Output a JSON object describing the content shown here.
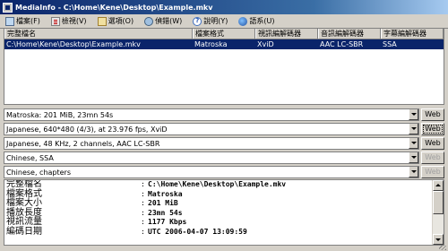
{
  "window": {
    "title": "MediaInfo - C:\\Home\\Kene\\Desktop\\Example.mkv"
  },
  "menu": [
    {
      "label": "檔案(F)",
      "icon": "file-icon"
    },
    {
      "label": "檢視(V)",
      "icon": "view-icon"
    },
    {
      "label": "選項(O)",
      "icon": "options-icon"
    },
    {
      "label": "偵錯(W)",
      "icon": "debug-icon"
    },
    {
      "label": "說明(Y)",
      "icon": "help-icon"
    },
    {
      "label": "語系(U)",
      "icon": "language-icon"
    }
  ],
  "table": {
    "headers": [
      "完整檔名",
      "檔案格式",
      "視訊編解碼器",
      "音訊編解碼器",
      "字幕編解碼器"
    ],
    "rows": [
      [
        "C:\\Home\\Kene\\Desktop\\Example.mkv",
        "Matroska",
        "XviD",
        "AAC LC-SBR",
        "SSA"
      ]
    ]
  },
  "streams": [
    {
      "value": "Matroska: 201 MiB, 23mn 54s",
      "web": "Web"
    },
    {
      "value": "Japanese, 640*480 (4/3),  at 23.976 fps, XviD",
      "web": "Web"
    },
    {
      "value": "Japanese, 48 KHz, 2 channels, AAC LC-SBR",
      "web": "Web"
    },
    {
      "value": "Chinese, SSA",
      "web": "Web"
    },
    {
      "value": "Chinese,  chapters",
      "web": "Web"
    }
  ],
  "details": [
    {
      "key": "完整檔名",
      "value": "C:\\Home\\Kene\\Desktop\\Example.mkv"
    },
    {
      "key": "檔案格式",
      "value": "Matroska"
    },
    {
      "key": "檔案大小",
      "value": "201 MiB"
    },
    {
      "key": "播放長度",
      "value": "23mn 54s"
    },
    {
      "key": "視訊流量",
      "value": "1177 Kbps"
    },
    {
      "key": "編碼日期",
      "value": "UTC 2006-04-07 13:09:59"
    }
  ]
}
